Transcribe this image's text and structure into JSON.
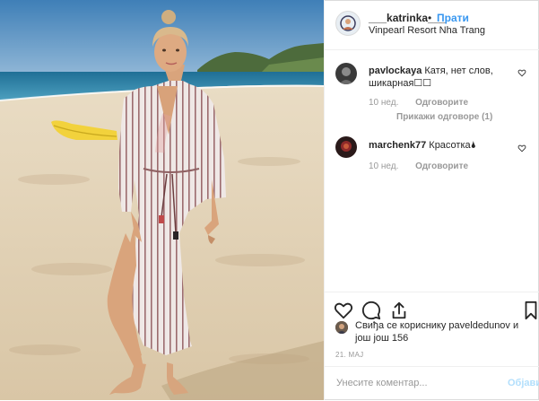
{
  "post": {
    "username": "___katrinka___",
    "separator": "•",
    "follow_label": "Прати",
    "location": "Vinpearl Resort Nha Trang"
  },
  "comments": [
    {
      "username": "pavlockaya",
      "text": "Катя, нет слов, шикарная☐☐",
      "age": "10 нед.",
      "reply_label": "Одговорите",
      "show_replies_label": "Прикажи одговоре (1)"
    },
    {
      "username": "marchenk77",
      "text": "Красотка🌢",
      "age": "10 нед.",
      "reply_label": "Одговорите"
    }
  ],
  "likes": {
    "text": "Свиђа се кориснику paveldedunov и још још 156"
  },
  "date": "21. МАЈ",
  "add_comment": {
    "placeholder": "Унесите коментар...",
    "post_label": "Објави"
  },
  "icons": {
    "like": "heart-icon",
    "comment": "comment-icon",
    "share": "share-icon",
    "save": "bookmark-icon"
  },
  "colors": {
    "link_blue": "#3897f0",
    "muted": "#999999",
    "text": "#262626",
    "post_disabled": "#b2dffc"
  }
}
